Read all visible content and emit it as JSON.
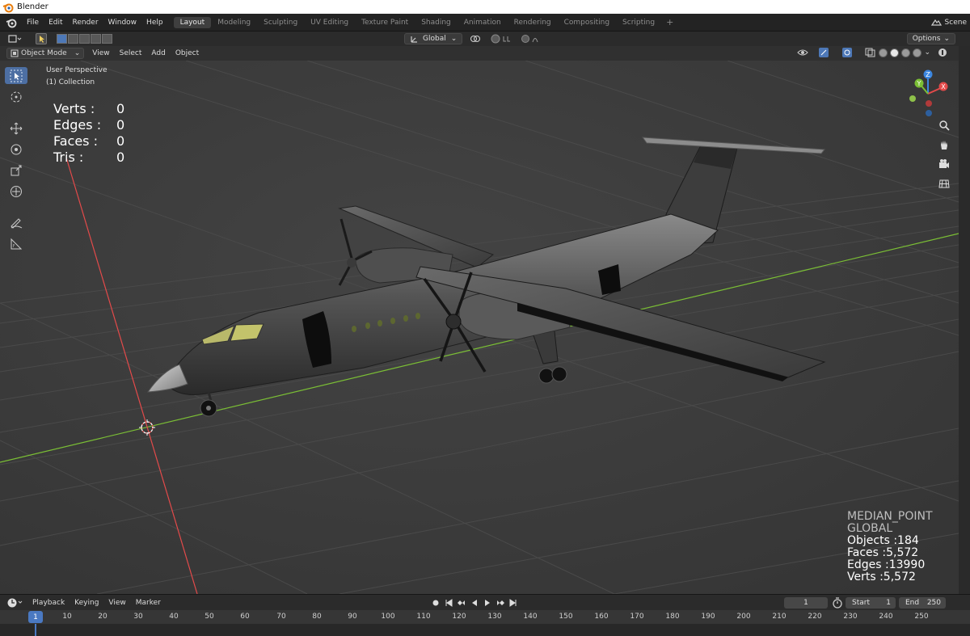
{
  "window": {
    "title": "Blender"
  },
  "menu": [
    "File",
    "Edit",
    "Render",
    "Window",
    "Help"
  ],
  "workspaces": [
    {
      "label": "Layout",
      "active": true
    },
    {
      "label": "Modeling",
      "active": false
    },
    {
      "label": "Sculpting",
      "active": false
    },
    {
      "label": "UV Editing",
      "active": false
    },
    {
      "label": "Texture Paint",
      "active": false
    },
    {
      "label": "Shading",
      "active": false
    },
    {
      "label": "Animation",
      "active": false
    },
    {
      "label": "Rendering",
      "active": false
    },
    {
      "label": "Compositing",
      "active": false
    },
    {
      "label": "Scripting",
      "active": false
    }
  ],
  "add_workspace": "+",
  "scene": {
    "label": "Scene"
  },
  "toolheader": {
    "orientation": "Global",
    "options": "Options"
  },
  "viewport_header": {
    "mode": "Object Mode",
    "menus": [
      "View",
      "Select",
      "Add",
      "Object"
    ]
  },
  "viewport": {
    "perspective": "User Perspective",
    "collection": "(1) Collection",
    "stats_left": [
      {
        "label": "Verts :",
        "value": "0"
      },
      {
        "label": "Edges :",
        "value": "0"
      },
      {
        "label": "Faces :",
        "value": "0"
      },
      {
        "label": "Tris :",
        "value": "0"
      }
    ],
    "stats_right": {
      "pivot": "MEDIAN_POINT",
      "orientation": "GLOBAL",
      "objects": "Objects :184",
      "faces": "Faces :5,572",
      "edges": "Edges :13990",
      "verts": "Verts :5,572"
    },
    "gizmo_axes": [
      "X",
      "Y",
      "Z"
    ]
  },
  "timeline": {
    "menus": [
      "Playback",
      "Keying",
      "View",
      "Marker"
    ],
    "current_frame": "1",
    "start_label": "Start",
    "start": "1",
    "end_label": "End",
    "end": "250",
    "ruler_current": "1",
    "ruler": [
      "10",
      "20",
      "30",
      "40",
      "50",
      "60",
      "70",
      "80",
      "90",
      "100",
      "110",
      "120",
      "130",
      "140",
      "150",
      "160",
      "170",
      "180",
      "190",
      "200",
      "210",
      "220",
      "230",
      "240",
      "250"
    ]
  },
  "colors": {
    "accent": "#4d78b7",
    "x_axis": "#e34a4a",
    "y_axis": "#7bbf35",
    "z_axis": "#3b86e0"
  }
}
